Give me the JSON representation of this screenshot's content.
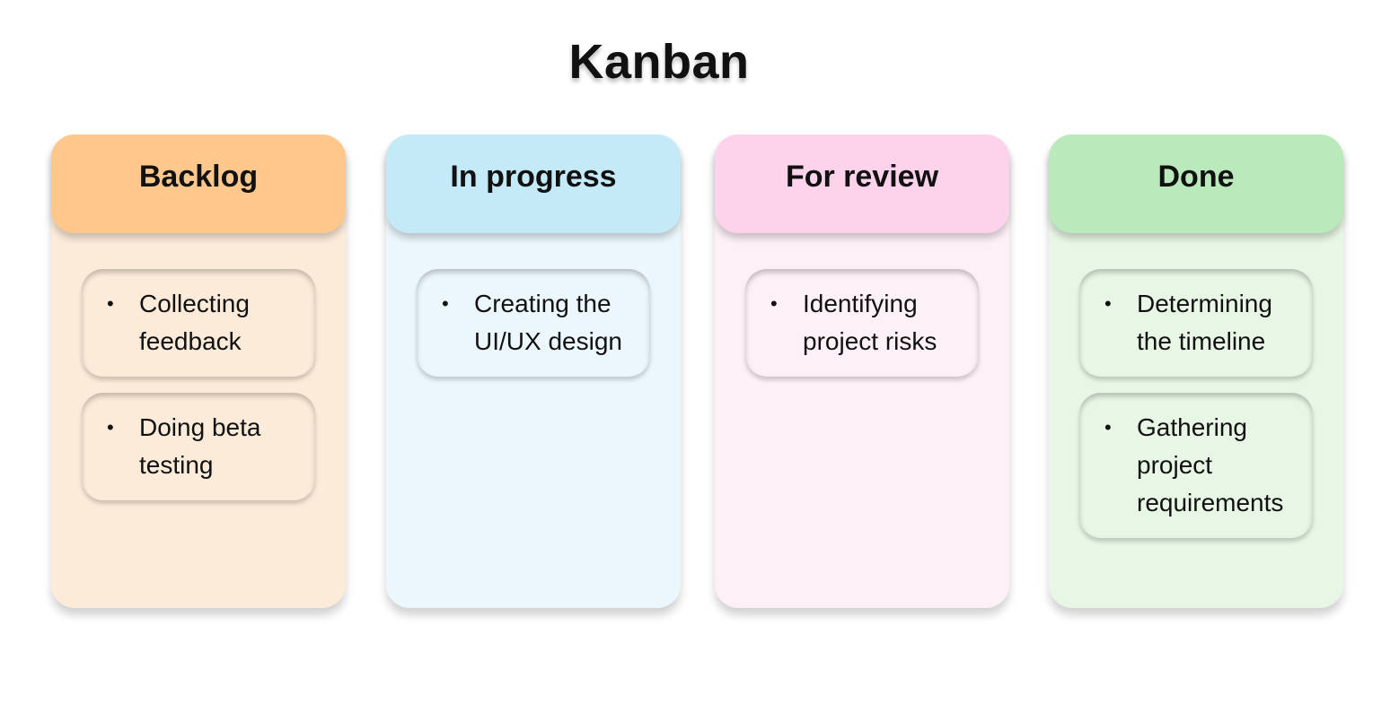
{
  "title": "Kanban",
  "columns": [
    {
      "name": "Backlog",
      "header_color": "#fec88c",
      "body_color": "#fdebd9",
      "cards": [
        "Collecting feedback",
        "Doing beta testing"
      ]
    },
    {
      "name": "In progress",
      "header_color": "#c4eaf8",
      "body_color": "#ebf7fc",
      "cards": [
        "Creating the UI/UX design"
      ]
    },
    {
      "name": "For review",
      "header_color": "#fdd2eb",
      "body_color": "#fdf0f6",
      "cards": [
        "Identifying project risks"
      ]
    },
    {
      "name": "Done",
      "header_color": "#bae9bb",
      "body_color": "#e7f6e5",
      "cards": [
        "Determining the timeline",
        "Gathering project requirements"
      ]
    }
  ]
}
